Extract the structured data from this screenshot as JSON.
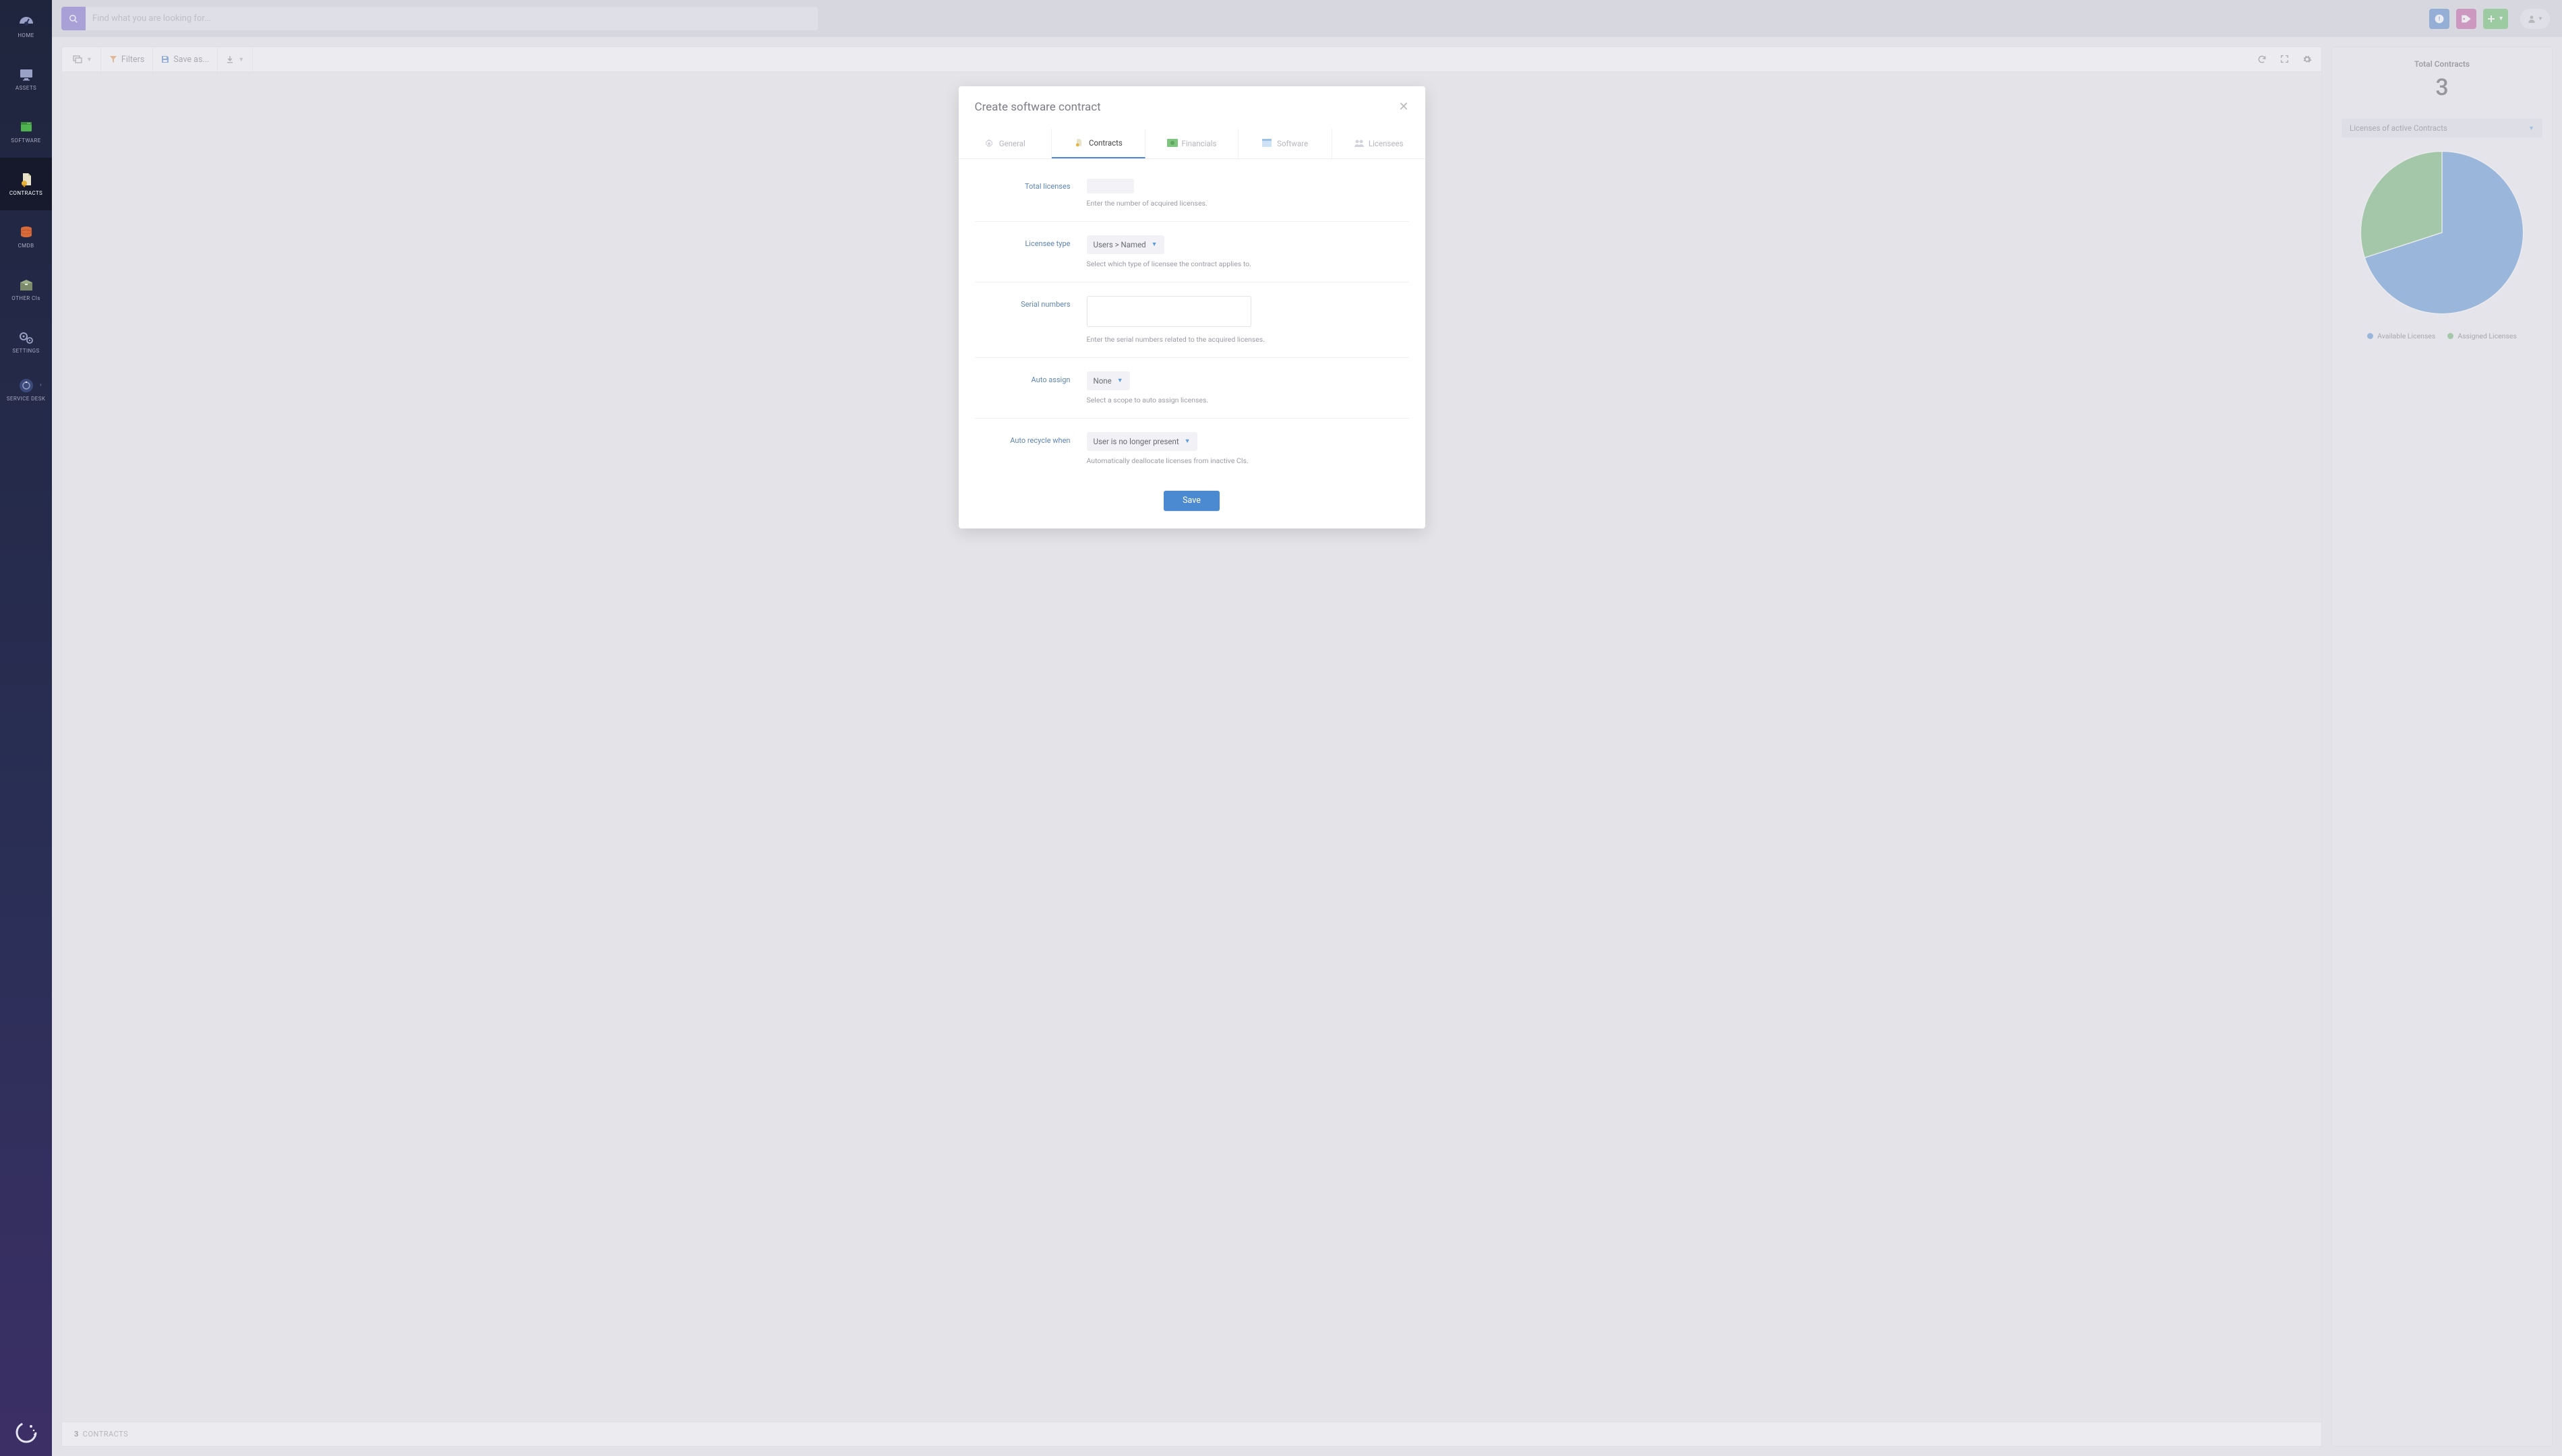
{
  "sidebar": {
    "items": [
      {
        "label": "HOME"
      },
      {
        "label": "ASSETS"
      },
      {
        "label": "SOFTWARE"
      },
      {
        "label": "CONTRACTS"
      },
      {
        "label": "CMDB"
      },
      {
        "label": "OTHER CIs"
      },
      {
        "label": "SETTINGS"
      },
      {
        "label": "SERVICE DESK"
      }
    ]
  },
  "search": {
    "placeholder": "Find what you are looking for..."
  },
  "toolbar": {
    "filters": "Filters",
    "save_as": "Save as..."
  },
  "footer": {
    "count": "3",
    "label": "CONTRACTS"
  },
  "rightpanel": {
    "title": "Total Contracts",
    "value": "3",
    "select": "Licenses of active Contracts",
    "legend": [
      {
        "label": "Available Licenses",
        "color": "#4b89d0"
      },
      {
        "label": "Assigned Licenses",
        "color": "#5fad62"
      }
    ]
  },
  "chart_data": {
    "type": "pie",
    "title": "Licenses of active Contracts",
    "series": [
      {
        "name": "Available Licenses",
        "value": 70,
        "color": "#4b89d0"
      },
      {
        "name": "Assigned Licenses",
        "value": 30,
        "color": "#5fad62"
      }
    ]
  },
  "modal": {
    "title": "Create software contract",
    "tabs": [
      {
        "label": "General"
      },
      {
        "label": "Contracts"
      },
      {
        "label": "Financials"
      },
      {
        "label": "Software"
      },
      {
        "label": "Licensees"
      }
    ],
    "fields": {
      "total_licenses": {
        "label": "Total licenses",
        "hint": "Enter the number of acquired licenses."
      },
      "licensee_type": {
        "label": "Licensee type",
        "value": "Users > Named",
        "hint": "Select which type of licensee the contract applies to."
      },
      "serial_numbers": {
        "label": "Serial numbers",
        "hint": "Enter the serial numbers related to the acquired licenses."
      },
      "auto_assign": {
        "label": "Auto assign",
        "value": "None",
        "hint": "Select a scope to auto assign licenses."
      },
      "auto_recycle": {
        "label": "Auto recycle when",
        "value": "User is no longer present",
        "hint": "Automatically deallocate licenses from inactive CIs."
      }
    },
    "save": "Save"
  }
}
